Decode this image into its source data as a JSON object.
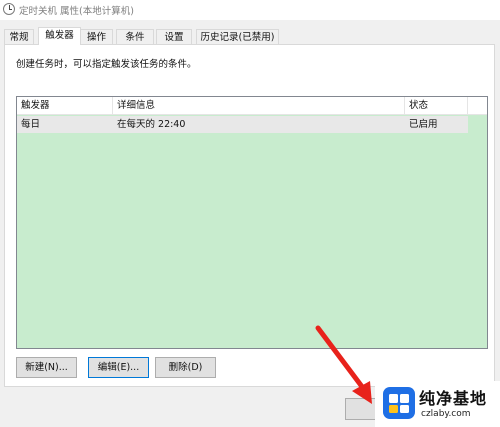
{
  "window": {
    "title": "定时关机 属性(本地计算机)"
  },
  "tabs": [
    {
      "label": "常规"
    },
    {
      "label": "触发器"
    },
    {
      "label": "操作"
    },
    {
      "label": "条件"
    },
    {
      "label": "设置"
    },
    {
      "label": "历史记录(已禁用)"
    }
  ],
  "active_tab": "触发器",
  "panel": {
    "description": "创建任务时，可以指定触发该任务的条件。"
  },
  "table": {
    "columns": [
      "触发器",
      "详细信息",
      "状态"
    ],
    "rows": [
      {
        "trigger": "每日",
        "details": "在每天的 22:40",
        "status": "已启用"
      }
    ]
  },
  "buttons": {
    "new": "新建(N)...",
    "edit": "编辑(E)...",
    "delete": "删除(D)"
  },
  "watermark": {
    "title": "纯净基地",
    "url": "czlaby.com"
  },
  "colors": {
    "list_background": "#c8ecce",
    "arrow": "#e8221b",
    "focus_border": "#0078d7"
  }
}
